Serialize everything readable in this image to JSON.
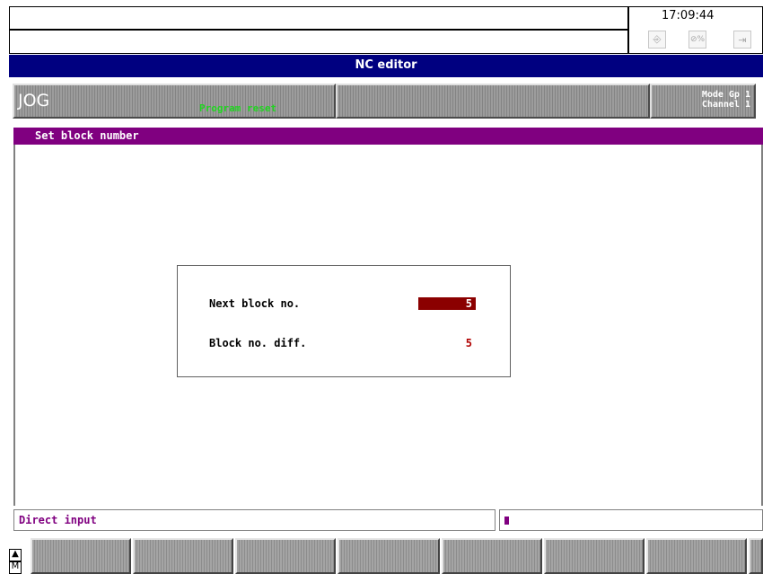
{
  "header": {
    "clock": "17:09:44",
    "toolbar_icons": [
      "enter-icon",
      "percent-icon",
      "exit-icon"
    ],
    "percent_glyph": "⊘%"
  },
  "title": "NC editor",
  "status": {
    "mode": "JOG",
    "program_state": "Program reset",
    "mode_group_label": "Mode Gp 1",
    "channel_label": "Channel 1"
  },
  "section_title": "Set block number",
  "dialog": {
    "next_block_label": "Next block no.",
    "next_block_value": "5",
    "block_diff_label": "Block no. diff.",
    "block_diff_value": "5"
  },
  "input_line": {
    "label": "Direct input"
  },
  "softkeys": {
    "count": 7,
    "left_arrows": [
      "▲",
      "M"
    ]
  },
  "colors": {
    "title_bar": "#000080",
    "section_bar": "#800080",
    "selected_value_bg": "#8b0000",
    "program_state": "#22d422"
  }
}
